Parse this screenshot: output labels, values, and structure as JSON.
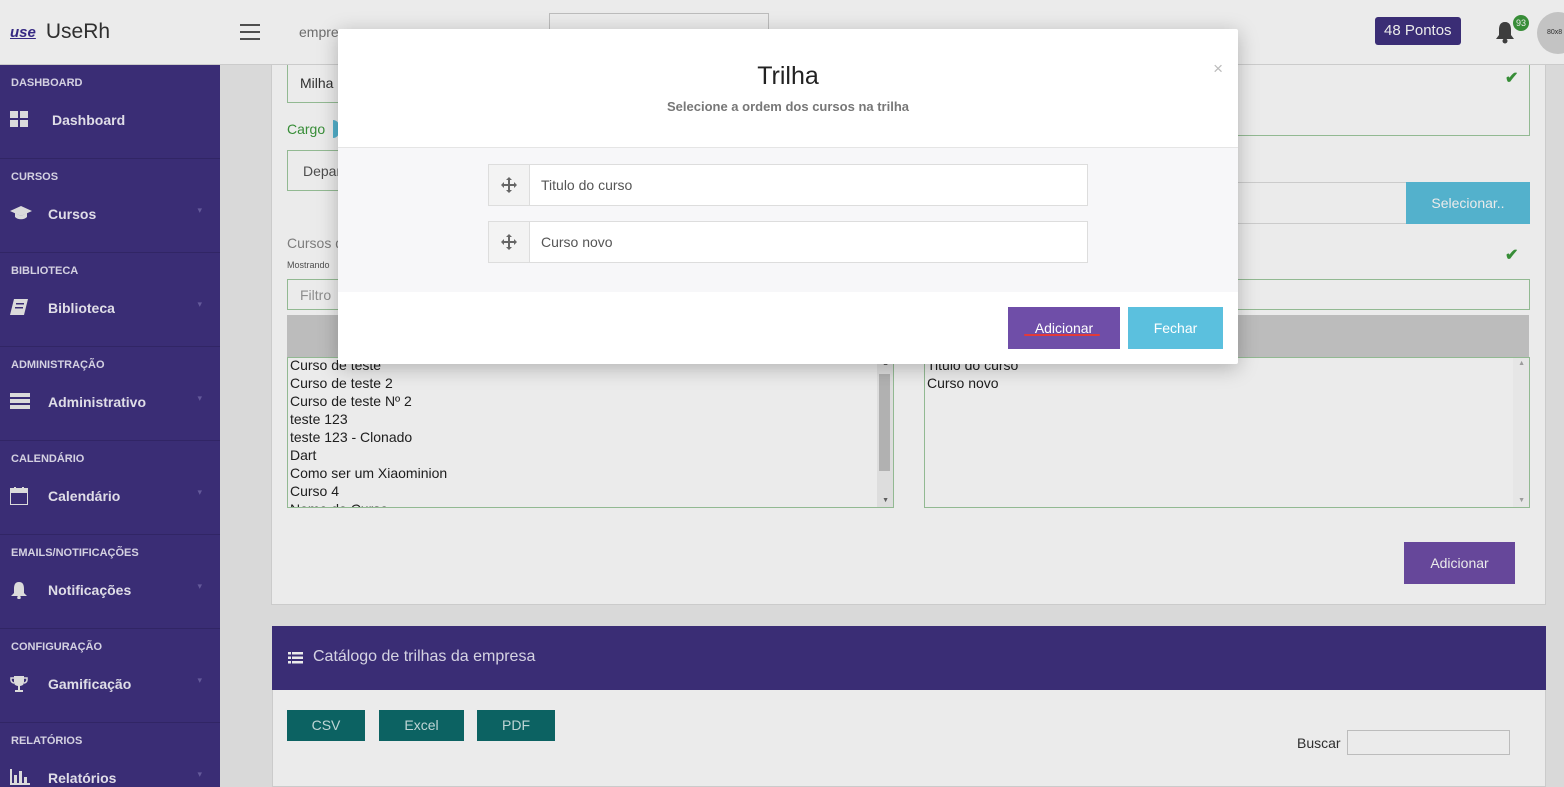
{
  "header": {
    "logo_mark": "use",
    "logo_text": "UseRh",
    "company_text": "empre",
    "points": "48 Pontos",
    "notification_count": "93",
    "avatar_text": "80x8"
  },
  "sidebar": {
    "sections": [
      {
        "heading": "DASHBOARD",
        "label": "Dashboard",
        "icon": "dashboard-icon"
      },
      {
        "heading": "CURSOS",
        "label": "Cursos",
        "icon": "graduation-cap-icon"
      },
      {
        "heading": "BIBLIOTECA",
        "label": "Biblioteca",
        "icon": "book-icon"
      },
      {
        "heading": "ADMINISTRAÇÃO",
        "label": "Administrativo",
        "icon": "list-icon"
      },
      {
        "heading": "CALENDÁRIO",
        "label": "Calendário",
        "icon": "calendar-icon"
      },
      {
        "heading": "EMAILS/NOTIFICAÇÕES",
        "label": "Notificações",
        "icon": "bell-icon"
      },
      {
        "heading": "CONFIGURAÇÃO",
        "label": "Gamificação",
        "icon": "trophy-icon"
      },
      {
        "heading": "RELATÓRIOS",
        "label": "Relatórios",
        "icon": "bar-chart-icon"
      }
    ]
  },
  "form": {
    "milha_value": "Milha",
    "cargo_label": "Cargo",
    "departamento_value": "Depar",
    "select_button": "Selecionar..",
    "cursos_label": "Cursos d",
    "mostrando_text": "Mostrando",
    "filter_placeholder": "Filtro",
    "available_courses": [
      "Curso de teste",
      "Curso de teste 2",
      "Curso de teste Nº 2",
      "teste 123",
      "teste 123 - Clonado",
      "Dart",
      "Como ser um Xiaominion",
      "Curso 4",
      "Nome do Curso"
    ],
    "selected_courses": [
      "Titulo do curso",
      "Curso novo"
    ],
    "add_button": "Adicionar"
  },
  "catalog": {
    "title": "Catálogo de trilhas da empresa",
    "export_buttons": [
      "CSV",
      "Excel",
      "PDF"
    ],
    "search_label": "Buscar"
  },
  "modal": {
    "title": "Trilha",
    "subtitle": "Selecione a ordem dos cursos na trilha",
    "close": "×",
    "items": [
      "Titulo do curso",
      "Curso novo"
    ],
    "add_button": "Adicionar",
    "close_button": "Fechar"
  },
  "colors": {
    "primary": "#3f317f",
    "purple_button": "#6f4ea8",
    "info": "#5bc0de",
    "teal": "#0e6b6b",
    "success": "#3c9a3c"
  }
}
